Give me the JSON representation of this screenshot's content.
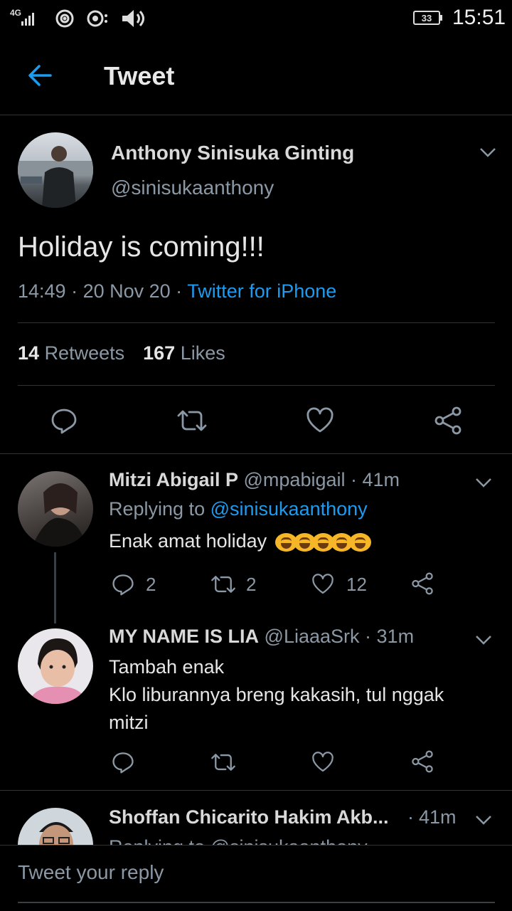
{
  "status_bar": {
    "network": "4G",
    "battery": "33",
    "time": "15:51"
  },
  "header": {
    "title": "Tweet"
  },
  "tweet": {
    "author_name": "Anthony Sinisuka Ginting",
    "author_handle": "@sinisukaanthony",
    "text": "Holiday is coming!!!",
    "time": "14:49",
    "date": "20 Nov 20",
    "source": "Twitter for iPhone",
    "retweets_count": "14",
    "retweets_label": "Retweets",
    "likes_count": "167",
    "likes_label": "Likes"
  },
  "replies": [
    {
      "name": "Mitzi Abigail P",
      "handle": "@mpabigail",
      "time": "41m",
      "replying_label": "Replying to",
      "replying_to": "@sinisukaanthony",
      "text": "Enak amat holiday",
      "reply_count": "2",
      "retweet_count": "2",
      "like_count": "12"
    },
    {
      "name": "MY NAME IS LIA",
      "handle": "@LiaaaSrk",
      "time": "31m",
      "text_lines": [
        "Tambah enak",
        "Klo liburannya breng kakasih, tul nggak",
        "mitzi"
      ]
    },
    {
      "name": "Shoffan Chicarito Hakim Akb...",
      "time": "41m",
      "replying_label": "Replying to @sinisukaanthony"
    }
  ],
  "composer": {
    "placeholder": "Tweet your reply"
  },
  "colors": {
    "accent": "#1d9bf0",
    "background": "#000000",
    "muted": "#8b98a5"
  }
}
